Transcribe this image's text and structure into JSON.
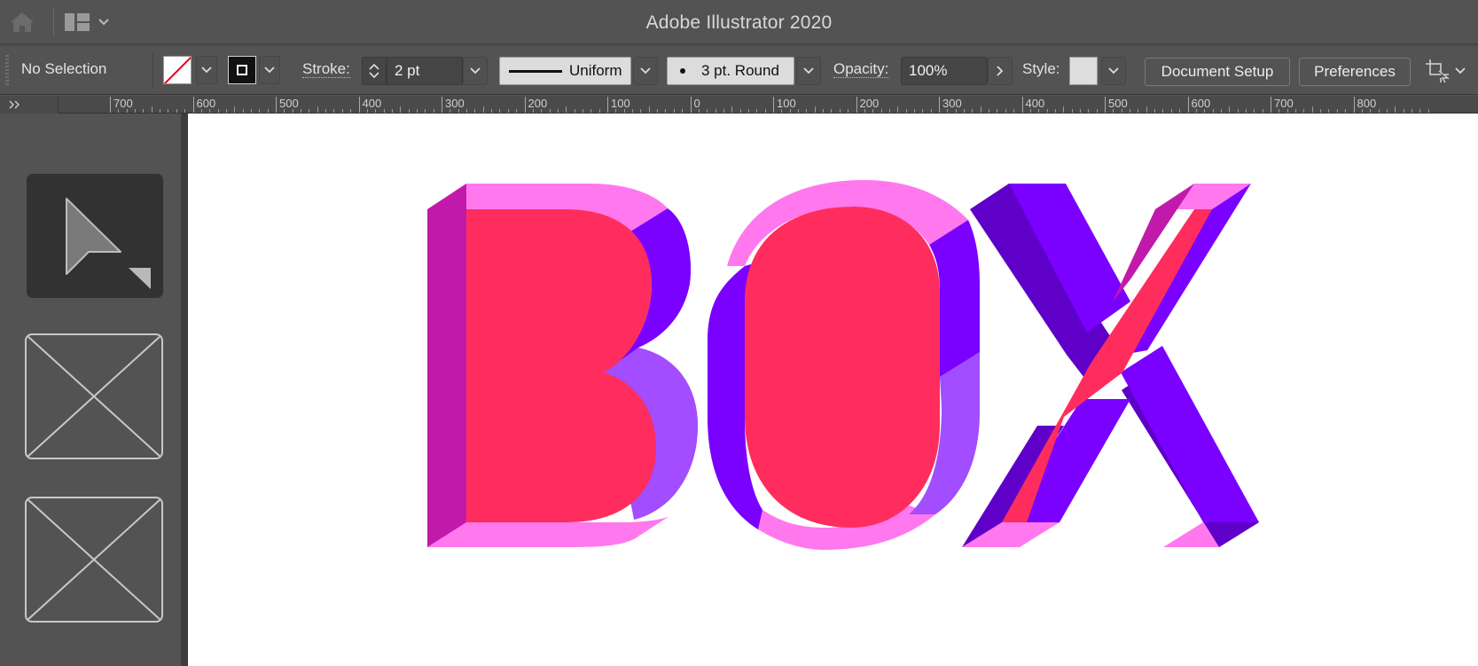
{
  "titlebar": {
    "app_title": "Adobe Illustrator 2020",
    "icons": [
      "home-icon",
      "workspace-switcher-icon",
      "chevron-down-icon"
    ]
  },
  "control_bar": {
    "selection_label": "No Selection",
    "fill": {
      "color": "none",
      "icon": "fill-none-swatch"
    },
    "stroke_color": "#111111",
    "stroke_label": "Stroke:",
    "stroke_weight": "2 pt",
    "variable_width_profile": "Uniform",
    "brush_definition": "3 pt. Round",
    "opacity_label": "Opacity:",
    "opacity_value": "100%",
    "style_label": "Style:",
    "document_setup_label": "Document Setup",
    "preferences_label": "Preferences",
    "arrange_icon": "arrange-documents-icon"
  },
  "ruler": {
    "collapse_icon": "double-chevron-right-icon",
    "labels": [
      "700",
      "600",
      "500",
      "400",
      "300",
      "200",
      "100",
      "0",
      "100",
      "200",
      "300",
      "400",
      "500",
      "600",
      "700",
      "800"
    ]
  },
  "tools_panel": {
    "active_tool": "selection-tool",
    "tools": [
      "selection-tool",
      "image-placeholder",
      "image-placeholder"
    ]
  },
  "artwork": {
    "text": "BOX",
    "colors": {
      "face": "#ff2d5e",
      "top_side": "#ff78ee",
      "left_side": "#c11aaa",
      "right_side": "#7a00ff",
      "right_side_light": "#a24dff",
      "dark_side": "#5f00c8"
    }
  }
}
